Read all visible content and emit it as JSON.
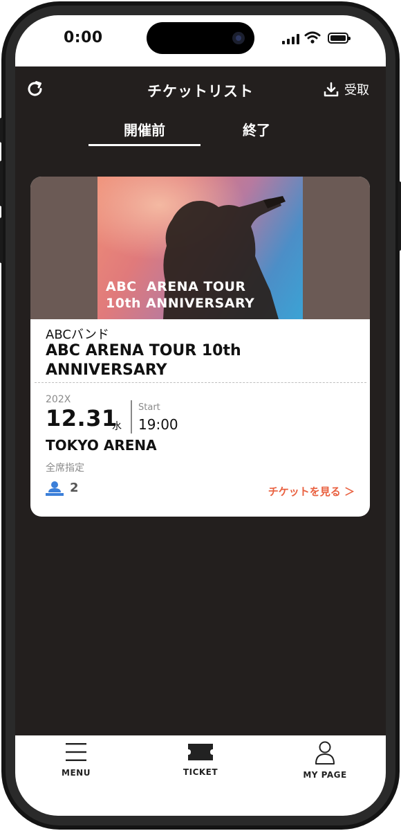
{
  "status_bar": {
    "time": "0:00"
  },
  "header": {
    "title": "チケットリスト",
    "receive_label": "受取"
  },
  "tabs": [
    {
      "label": "開催前",
      "active": true
    },
    {
      "label": "終了",
      "active": false
    }
  ],
  "ticket": {
    "poster_title": "ABC  ARENA TOUR\n10th ANNIVERSARY",
    "artist": "ABCバンド",
    "event_title": "ABC  ARENA TOUR 10th ANNIVERSARY",
    "year": "202X",
    "date": "12.31",
    "weekday": "水",
    "start_label": "Start",
    "start_time": "19:00",
    "venue": "TOKYO ARENA",
    "seat_type": "全席指定",
    "count": "2",
    "view_label": "チケットを見る ＞"
  },
  "bottom_nav": [
    {
      "label": "MENU",
      "icon": "menu-icon"
    },
    {
      "label": "TICKET",
      "icon": "ticket-icon"
    },
    {
      "label": "MY PAGE",
      "icon": "person-icon"
    }
  ],
  "colors": {
    "background": "#231f1e",
    "accent": "#e9603f",
    "icon_blue": "#3b7fd9"
  }
}
